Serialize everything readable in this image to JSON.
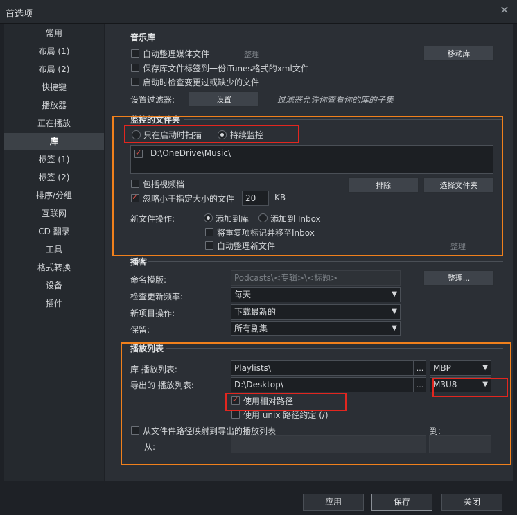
{
  "window": {
    "title": "首选项"
  },
  "sidebar": {
    "items": [
      "常用",
      "布局 (1)",
      "布局 (2)",
      "快捷键",
      "播放器",
      "正在播放",
      "库",
      "标签 (1)",
      "标签 (2)",
      "排序/分组",
      "互联网",
      "CD 翻录",
      "工具",
      "格式转换",
      "设备",
      "插件"
    ],
    "active": "库"
  },
  "library": {
    "title": "音乐库",
    "auto_organize": "自动整理媒体文件",
    "organize_btn": "整理",
    "move_btn": "移动库",
    "save_itunes": "保存库文件标签到一份iTunes格式的xml文件",
    "check_on_start": "启动时检查变更过或缺少的文件",
    "filter_label": "设置过滤器:",
    "filter_btn": "设置",
    "filter_hint": "过滤器允许你查看你的库的子集"
  },
  "monitor": {
    "title": "监控的文件夹",
    "scan_on_start": "只在启动时扫描",
    "continuous": "持续监控",
    "folder": "D:\\OneDrive\\Music\\",
    "include_video": "包括视频档",
    "exclude_btn": "排除",
    "choose_btn": "选择文件夹",
    "ignore_small": "忽略小于指定大小的文件",
    "size_value": "20",
    "size_unit": "KB",
    "new_file_label": "新文件操作:",
    "add_to_library": "添加到库",
    "add_to_inbox": "添加到 Inbox",
    "mark_duplicates": "将重复项标记并移至Inbox",
    "auto_organize_new": "自动整理新文件",
    "organize_btn": "整理"
  },
  "podcast": {
    "title": "播客",
    "naming_label": "命名模版:",
    "naming_value": "Podcasts\\<专辑>\\<标题>",
    "organize_btn": "整理...",
    "check_freq_label": "检查更新频率:",
    "check_freq_value": "每天",
    "new_item_label": "新项目操作:",
    "new_item_value": "下载最新的",
    "keep_label": "保留:",
    "keep_value": "所有剧集"
  },
  "playlist": {
    "title": "播放列表",
    "lib_label": "库 播放列表:",
    "lib_path": "Playlists\\",
    "lib_format": "MBP",
    "export_label": "导出的 播放列表:",
    "export_path": "D:\\Desktop\\",
    "export_format": "M3U8",
    "dots": "...",
    "relative_path": "使用相对路径",
    "unix_path": "使用 unix 路径约定 (/)",
    "map_paths": "从文件件路径映射到导出的播放列表",
    "to_label": "到:",
    "from_label": "从:"
  },
  "footer": {
    "apply": "应用",
    "save": "保存",
    "close": "关闭"
  },
  "colors": {
    "highlight_orange": "#f0801c",
    "highlight_red": "#e2261f",
    "check_red": "#e0524a"
  }
}
